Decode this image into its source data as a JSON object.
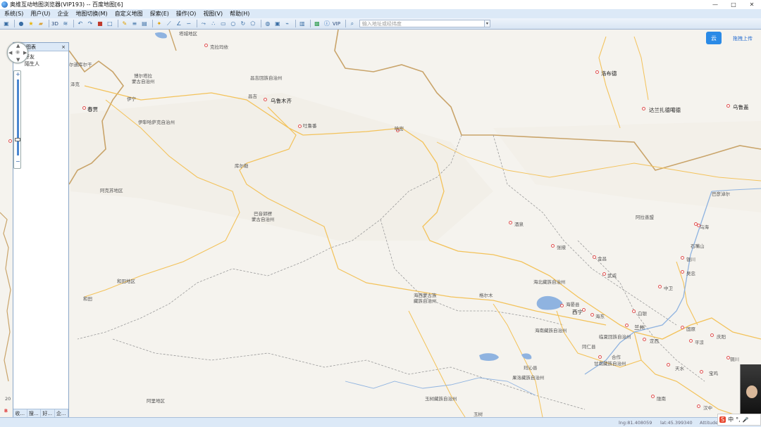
{
  "window": {
    "title": "奥维互动地图浏览器(VIP193) -- 百度地图[6]",
    "controls": [
      "—",
      "□",
      "✕"
    ]
  },
  "menu": [
    "系统(S)",
    "用户(U)",
    "企业",
    "地图切换(M)",
    "自定义地图",
    "探索(E)",
    "操作(O)",
    "视图(V)",
    "帮助(H)"
  ],
  "toolbar": {
    "label_3d": "3D",
    "vip": "VIP",
    "search_placeholder": "输入地址或经纬度"
  },
  "panel": {
    "title": "图表",
    "close": "×",
    "items": [
      "好友",
      "陌生人"
    ],
    "tabs": [
      "收...",
      "搜...",
      "好...",
      "企..."
    ]
  },
  "cloud": {
    "icon_text": "云",
    "label": "拖拽上传"
  },
  "status": {
    "lng": "lng:81.408059",
    "lat": "lat:45.399340",
    "extra": "Attitude:"
  },
  "ime": [
    "中",
    "°,",
    "🎤"
  ],
  "scale": "20",
  "map_labels": [
    {
      "text": "塔城地区",
      "cls": ""
    },
    {
      "text": "克拉玛依",
      "cls": ""
    },
    {
      "text": "尔通库尔干",
      "cls": ""
    },
    {
      "text": "博尔塔拉",
      "cls": ""
    },
    {
      "text": "蒙古自治州",
      "cls": ""
    },
    {
      "text": "昌吉回族自治州",
      "cls": ""
    },
    {
      "text": "昌吉",
      "cls": ""
    },
    {
      "text": "乌鲁木齐",
      "cls": "big"
    },
    {
      "text": "伊宁",
      "cls": ""
    },
    {
      "text": "伊犁哈萨克自治州",
      "cls": ""
    },
    {
      "text": "吐鲁番",
      "cls": ""
    },
    {
      "text": "哈密",
      "cls": ""
    },
    {
      "text": "春贾",
      "cls": ""
    },
    {
      "text": "泽克",
      "cls": ""
    },
    {
      "text": "库尔勒",
      "cls": ""
    },
    {
      "text": "阿克苏地区",
      "cls": ""
    },
    {
      "text": "巴音郭楞",
      "cls": ""
    },
    {
      "text": "蒙古自治州",
      "cls": ""
    },
    {
      "text": "和田地区",
      "cls": ""
    },
    {
      "text": "和田",
      "cls": ""
    },
    {
      "text": "海西蒙古族",
      "cls": ""
    },
    {
      "text": "藏族自治州",
      "cls": ""
    },
    {
      "text": "格尔木",
      "cls": ""
    },
    {
      "text": "玉树藏族自治州",
      "cls": ""
    },
    {
      "text": "阿里地区",
      "cls": ""
    },
    {
      "text": "玉树",
      "cls": ""
    },
    {
      "text": "洛布德",
      "cls": ""
    },
    {
      "text": "达兰扎德噶德",
      "cls": ""
    },
    {
      "text": "乌鲁盖",
      "cls": ""
    },
    {
      "text": "巴彦淖尔",
      "cls": ""
    },
    {
      "text": "阿拉善盟",
      "cls": ""
    },
    {
      "text": "乌海",
      "cls": ""
    },
    {
      "text": "石嘴山",
      "cls": ""
    },
    {
      "text": "银川",
      "cls": ""
    },
    {
      "text": "吴忠",
      "cls": ""
    },
    {
      "text": "酒泉",
      "cls": ""
    },
    {
      "text": "张掖",
      "cls": ""
    },
    {
      "text": "金昌",
      "cls": ""
    },
    {
      "text": "武威",
      "cls": ""
    },
    {
      "text": "中卫",
      "cls": ""
    },
    {
      "text": "海北藏族自治州",
      "cls": ""
    },
    {
      "text": "海晏县",
      "cls": ""
    },
    {
      "text": "西宁",
      "cls": "big"
    },
    {
      "text": "海东",
      "cls": ""
    },
    {
      "text": "白银",
      "cls": ""
    },
    {
      "text": "兰州",
      "cls": "big"
    },
    {
      "text": "海南藏族自治州",
      "cls": ""
    },
    {
      "text": "临夏回族自治州",
      "cls": ""
    },
    {
      "text": "同仁县",
      "cls": ""
    },
    {
      "text": "合作",
      "cls": ""
    },
    {
      "text": "甘南藏族自治州",
      "cls": ""
    },
    {
      "text": "定西",
      "cls": ""
    },
    {
      "text": "固原",
      "cls": ""
    },
    {
      "text": "庆阳",
      "cls": ""
    },
    {
      "text": "平凉",
      "cls": ""
    },
    {
      "text": "果洛藏族自治州",
      "cls": ""
    },
    {
      "text": "玛沁县",
      "cls": ""
    },
    {
      "text": "天水",
      "cls": ""
    },
    {
      "text": "宝鸡",
      "cls": ""
    },
    {
      "text": "陇南",
      "cls": ""
    },
    {
      "text": "汉中",
      "cls": ""
    },
    {
      "text": "铜川",
      "cls": ""
    }
  ]
}
